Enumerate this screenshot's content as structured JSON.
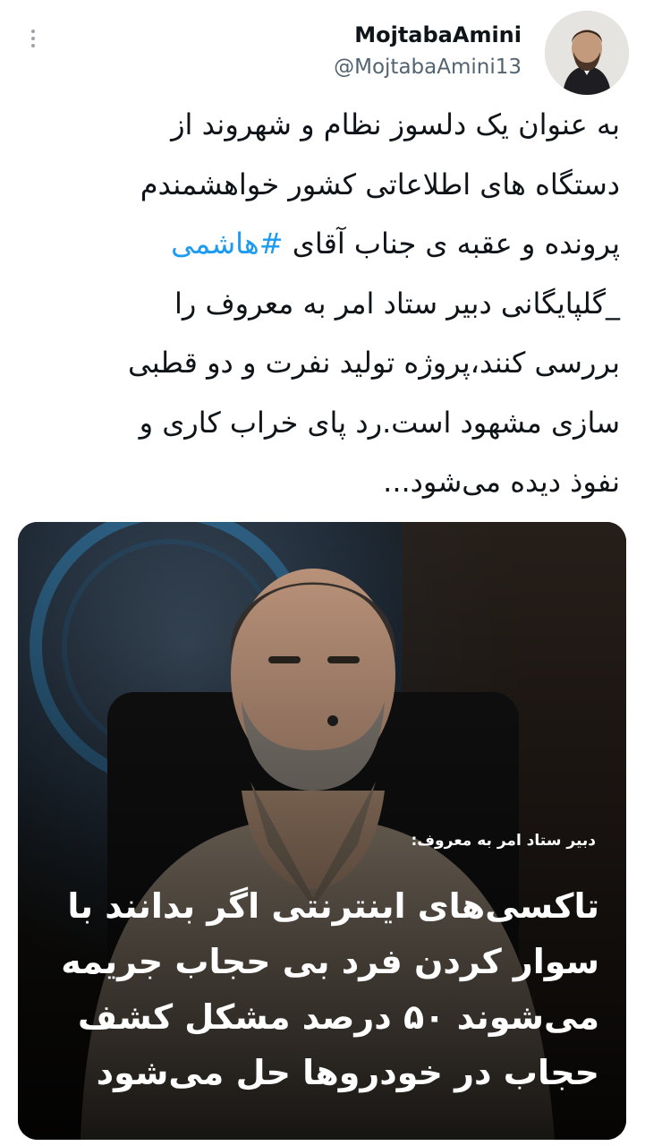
{
  "author": {
    "display_name": "MojtabaAmini",
    "handle": "@MojtabaAmini13"
  },
  "tweet": {
    "lines": [
      "به عنوان یک دلسوز نظام و شهروند از",
      "دستگاه های اطلاعاتی کشور خواهشمندم",
      "پرونده و عقبه ی جناب آقای ",
      "_گلپایگانی دبیر ستاد امر به معروف را",
      "بررسی کنند،پروژه تولید نفرت و دو قطبی",
      "سازی مشهود است.رد پای خراب کاری و",
      "نفوذ دیده می‌شود..."
    ],
    "hashtag": "#هاشمی"
  },
  "media": {
    "caption_small": "دبیر ستاد امر به معروف:",
    "caption_lines": [
      "تاکسی‌های اینترنتی اگر بدانند با",
      "سوار کردن فرد بی حجاب جریمه",
      "می‌شوند ۵۰ درصد مشکل کشف",
      "حجاب در خودروها حل می‌شود"
    ]
  },
  "icons": {
    "more": "more-vertical-icon"
  },
  "colors": {
    "text": "#0f1419",
    "secondary": "#536471",
    "link": "#1d9bf0"
  }
}
